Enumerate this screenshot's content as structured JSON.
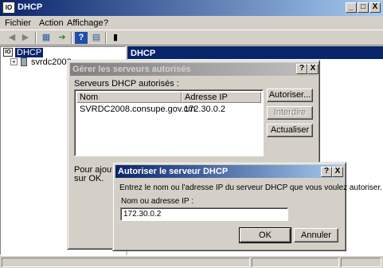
{
  "window": {
    "title": "DHCP",
    "min": "_",
    "max": "□",
    "close": "X"
  },
  "menu": [
    "Fichier",
    "Action",
    "Affichage",
    "?"
  ],
  "tree": {
    "root": "DHCP",
    "server": "svrdc2008.c"
  },
  "right_header": "DHCP",
  "manage_dialog": {
    "title": "Gérer les serveurs autorisés",
    "help": "?",
    "close": "X",
    "list_label": "Serveurs DHCP autorisés :",
    "columns": [
      "Nom",
      "Adresse IP"
    ],
    "rows": [
      {
        "name": "SVRDC2008.consupe.gov.cm",
        "ip": "172.30.0.2"
      }
    ],
    "authorize": "Autoriser...",
    "unauthorize": "Interdire",
    "refresh": "Actualiser",
    "footer_line1": "Pour ajouter u",
    "footer_line2": "sur OK."
  },
  "authorize_dialog": {
    "title": "Autoriser le serveur DHCP",
    "help": "?",
    "close": "X",
    "instruction": "Entrez le nom ou l'adresse IP du serveur DHCP que vous voulez autoriser.",
    "field_label": "Nom ou adresse IP :",
    "field_value": "172.30.0.2",
    "ok": "OK",
    "cancel": "Annuler"
  }
}
